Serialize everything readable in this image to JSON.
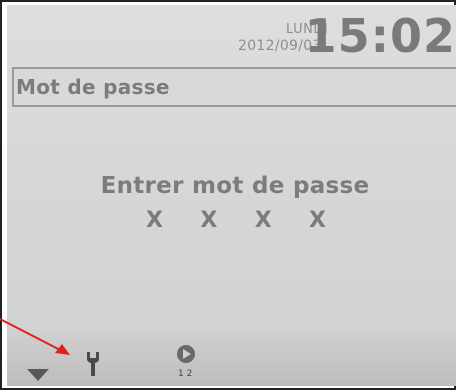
{
  "header": {
    "day": "LUNDI",
    "date": "2012/09/03",
    "time": "15:02"
  },
  "title": "Mot de passe",
  "main": {
    "prompt": "Entrer mot de passe",
    "password_mask": [
      "X",
      "X",
      "X",
      "X"
    ]
  },
  "bottom_bar": {
    "icons": [
      "arrow-down-icon",
      "wrench-icon",
      "play-icon"
    ],
    "page_indicator": "1 2"
  },
  "colors": {
    "screen_bg": "#d9d9d9",
    "text": "#7c7c7c",
    "annotation_arrow": "#e02020"
  }
}
